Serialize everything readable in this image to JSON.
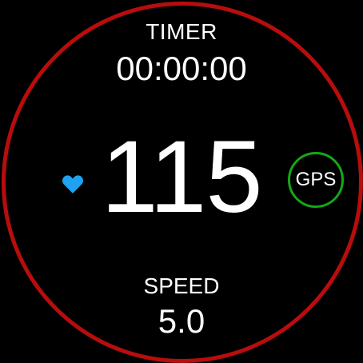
{
  "timer": {
    "label": "TIMER",
    "value": "00:00:00"
  },
  "heart_rate": {
    "value": "115",
    "icon": "heart-icon",
    "icon_color": "#1ea2f2"
  },
  "gps": {
    "label": "GPS",
    "status_color": "#14a814"
  },
  "speed": {
    "label": "SPEED",
    "value": "5.0"
  },
  "colors": {
    "ring": "#b80d0d",
    "background": "#000000",
    "text": "#ffffff"
  }
}
